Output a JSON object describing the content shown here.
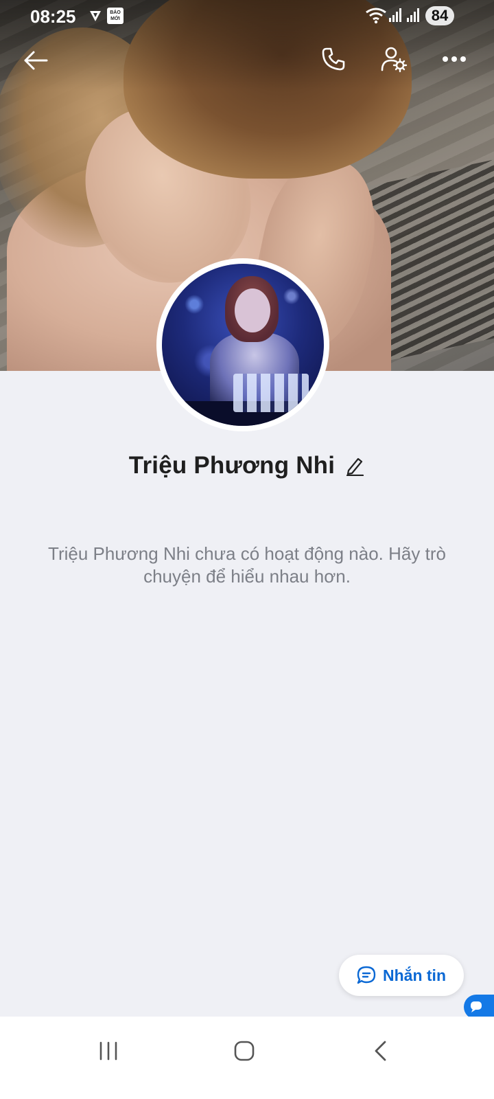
{
  "status_bar": {
    "time": "08:25",
    "app_badge_text": "BÁO MỚI",
    "battery": "84"
  },
  "header": {
    "icons": [
      "back-arrow-icon",
      "phone-icon",
      "user-settings-icon",
      "more-icon"
    ]
  },
  "profile": {
    "name": "Triệu Phương Nhi",
    "empty_message": "Triệu Phương Nhi chưa có hoạt động nào. Hãy trò chuyện để hiểu nhau hơn."
  },
  "actions": {
    "message_label": "Nhắn tin"
  },
  "colors": {
    "accent": "#0a68d4",
    "background": "#eff0f5",
    "secondary_text": "#7c7f87"
  },
  "navigation": {
    "icons": [
      "recents-icon",
      "home-icon",
      "back-icon"
    ]
  }
}
